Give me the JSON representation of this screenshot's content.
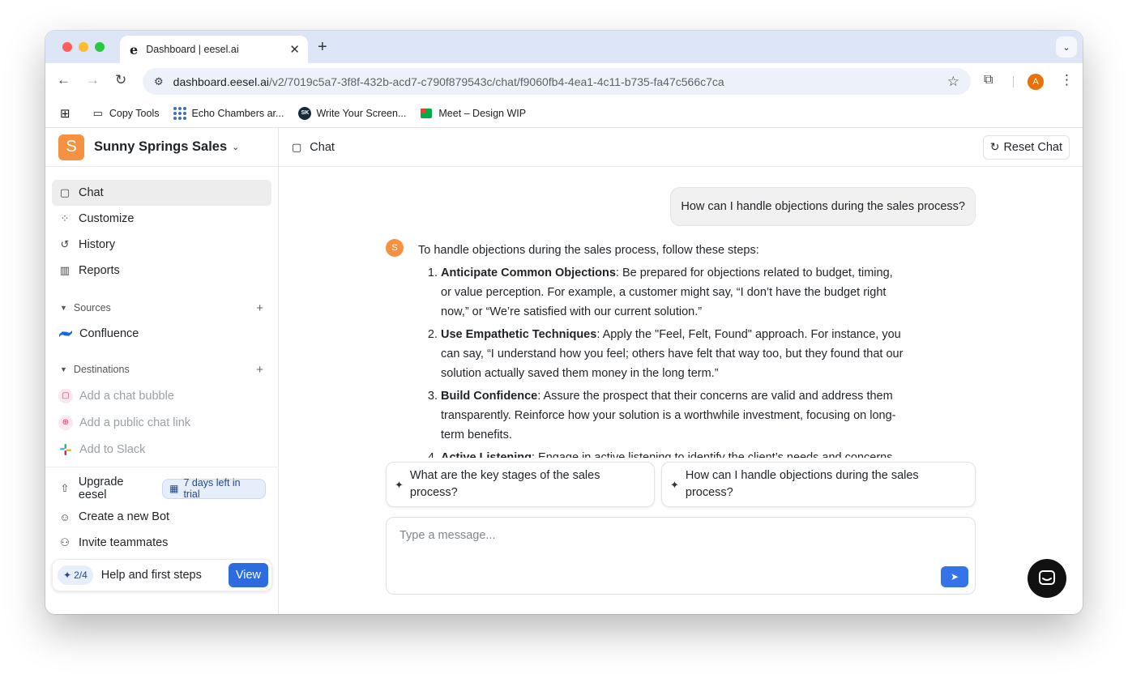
{
  "browser": {
    "tab_title": "Dashboard | eesel.ai",
    "tab_favicon": "e",
    "url_host": "dashboard.eesel.ai",
    "url_path": "/v2/7019c5a7-3f8f-432b-acd7-c790f879543c/chat/f9060fb4-4ea1-4c11-b735-fa47c566c7ca",
    "profile_initial": "A",
    "bookmarks": [
      "Copy Tools",
      "Echo Chambers ar...",
      "Write Your Screen...",
      "Meet – Design WIP"
    ],
    "sk_badge": "SK"
  },
  "workspace": {
    "logo_letter": "S",
    "name": "Sunny Springs Sales"
  },
  "nav": [
    {
      "label": "Chat",
      "icon": "chat-bubble-icon",
      "active": true
    },
    {
      "label": "Customize",
      "icon": "customize-icon"
    },
    {
      "label": "History",
      "icon": "history-icon"
    },
    {
      "label": "Reports",
      "icon": "reports-icon"
    }
  ],
  "sources": {
    "title": "Sources",
    "items": [
      {
        "label": "Confluence",
        "icon": "confluence-icon"
      }
    ]
  },
  "destinations": {
    "title": "Destinations",
    "items": [
      {
        "label": "Add a chat bubble",
        "icon": "chat-bubble-icon"
      },
      {
        "label": "Add a public chat link",
        "icon": "globe-icon"
      },
      {
        "label": "Add to Slack",
        "icon": "slack-icon"
      }
    ]
  },
  "bottom": {
    "upgrade_label": "Upgrade eesel",
    "trial_badge": "7 days left in trial",
    "create_bot": "Create a new Bot",
    "invite": "Invite teammates",
    "help_progress": "2/4",
    "help_label": "Help and first steps",
    "view_button": "View"
  },
  "main": {
    "header_title": "Chat",
    "reset_button": "Reset Chat",
    "user_message": "How can I handle objections during the sales process?",
    "bot_avatar": "S",
    "bot_intro": "To handle objections during the sales process, follow these steps:",
    "steps": [
      {
        "title": "Anticipate Common Objections",
        "text": ": Be prepared for objections related to budget, timing, or value perception. For example, a customer might say, “I don’t have the budget right now,” or “We’re satisfied with our current solution.”"
      },
      {
        "title": "Use Empathetic Techniques",
        "text": ": Apply the \"Feel, Felt, Found\" approach. For instance, you can say, “I understand how you feel; others have felt that way too, but they found that our solution actually saved them money in the long term.”"
      },
      {
        "title": "Build Confidence",
        "text": ": Assure the prospect that their concerns are valid and address them transparently. Reinforce how your solution is a worthwhile investment, focusing on long-term benefits."
      },
      {
        "title": "Active Listening",
        "text": ": Engage in active listening to identify the client’s needs and concerns."
      }
    ],
    "suggestions": [
      "What are the key stages of the sales process?",
      "How can I handle objections during the sales process?"
    ],
    "composer_placeholder": "Type a message..."
  },
  "colors": {
    "accent": "#2d6cdf",
    "brand_orange": "#f59242"
  }
}
